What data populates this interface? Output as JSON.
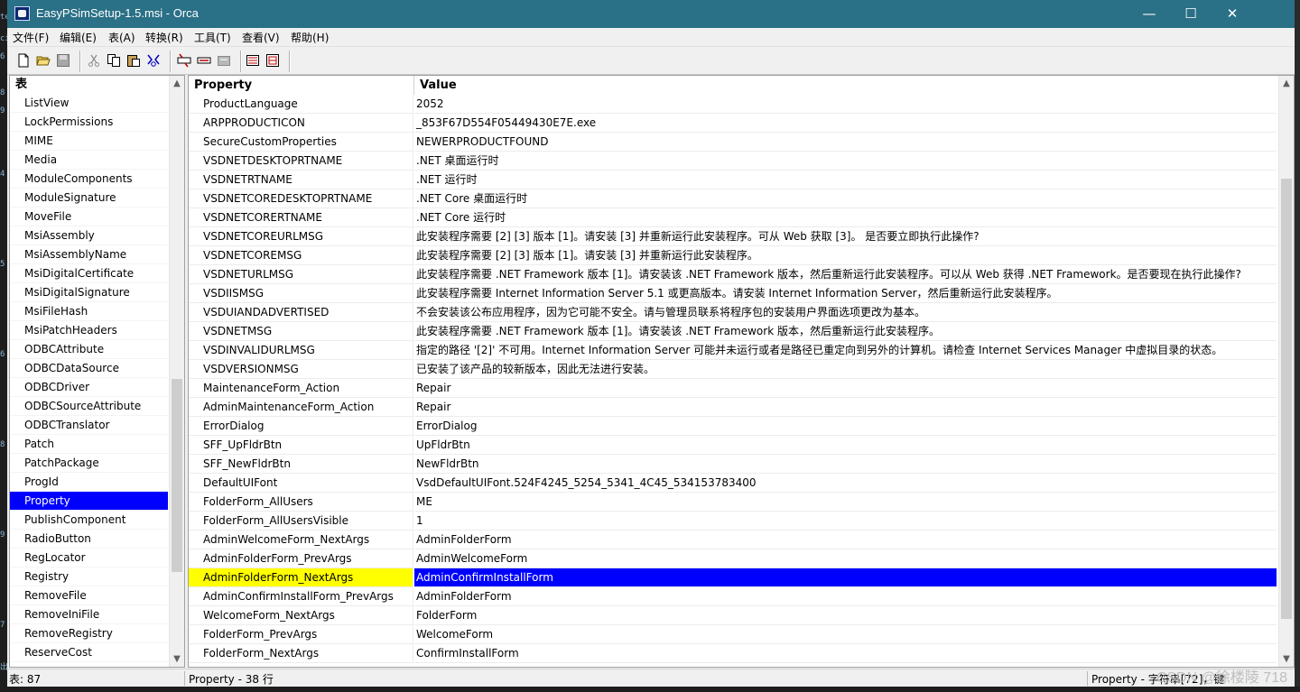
{
  "window": {
    "title": "EasyPSimSetup-1.5.msi - Orca",
    "minimize": "—",
    "maximize": "☐",
    "close": "✕"
  },
  "menu": [
    "文件(F)",
    "编辑(E)",
    "表(A)",
    "转换(R)",
    "工具(T)",
    "查看(V)",
    "帮助(H)"
  ],
  "tables_header": "表",
  "tables": [
    "ListView",
    "LockPermissions",
    "MIME",
    "Media",
    "ModuleComponents",
    "ModuleSignature",
    "MoveFile",
    "MsiAssembly",
    "MsiAssemblyName",
    "MsiDigitalCertificate",
    "MsiDigitalSignature",
    "MsiFileHash",
    "MsiPatchHeaders",
    "ODBCAttribute",
    "ODBCDataSource",
    "ODBCDriver",
    "ODBCSourceAttribute",
    "ODBCTranslator",
    "Patch",
    "PatchPackage",
    "ProgId",
    "Property",
    "PublishComponent",
    "RadioButton",
    "RegLocator",
    "Registry",
    "RemoveFile",
    "RemoveIniFile",
    "RemoveRegistry",
    "ReserveCost"
  ],
  "selected_table": "Property",
  "grid": {
    "columns": [
      "Property",
      "Value"
    ],
    "highlight_property": "AdminFolderForm_NextArgs",
    "rows": [
      [
        "ProductLanguage",
        "2052"
      ],
      [
        "ARPPRODUCTICON",
        "_853F67D554F05449430E7E.exe"
      ],
      [
        "SecureCustomProperties",
        "NEWERPRODUCTFOUND"
      ],
      [
        "VSDNETDESKTOPRTNAME",
        ".NET 桌面运行时"
      ],
      [
        "VSDNETRTNAME",
        ".NET 运行时"
      ],
      [
        "VSDNETCOREDESKTOPRTNAME",
        ".NET Core 桌面运行时"
      ],
      [
        "VSDNETCORERTNAME",
        ".NET Core 运行时"
      ],
      [
        "VSDNETCOREURLMSG",
        "此安装程序需要 [2] [3] 版本 [1]。请安装 [3] 并重新运行此安装程序。可从 Web 获取 [3]。 是否要立即执行此操作?"
      ],
      [
        "VSDNETCOREMSG",
        "此安装程序需要 [2] [3] 版本 [1]。请安装 [3] 并重新运行此安装程序。"
      ],
      [
        "VSDNETURLMSG",
        "此安装程序需要 .NET Framework 版本 [1]。请安装该 .NET Framework 版本，然后重新运行此安装程序。可以从 Web 获得 .NET Framework。是否要现在执行此操作?"
      ],
      [
        "VSDIISMSG",
        "此安装程序需要 Internet Information Server 5.1 或更高版本。请安装 Internet Information Server，然后重新运行此安装程序。"
      ],
      [
        "VSDUIANDADVERTISED",
        "不会安装该公布应用程序，因为它可能不安全。请与管理员联系将程序包的安装用户界面选项更改为基本。"
      ],
      [
        "VSDNETMSG",
        "此安装程序需要 .NET Framework 版本 [1]。请安装该 .NET Framework 版本，然后重新运行此安装程序。"
      ],
      [
        "VSDINVALIDURLMSG",
        "指定的路径 '[2]' 不可用。Internet Information Server 可能并未运行或者是路径已重定向到另外的计算机。请检查 Internet Services Manager 中虚拟目录的状态。"
      ],
      [
        "VSDVERSIONMSG",
        "已安装了该产品的较新版本，因此无法进行安装。"
      ],
      [
        "MaintenanceForm_Action",
        "Repair"
      ],
      [
        "AdminMaintenanceForm_Action",
        "Repair"
      ],
      [
        "ErrorDialog",
        "ErrorDialog"
      ],
      [
        "SFF_UpFldrBtn",
        "UpFldrBtn"
      ],
      [
        "SFF_NewFldrBtn",
        "NewFldrBtn"
      ],
      [
        "DefaultUIFont",
        "VsdDefaultUIFont.524F4245_5254_5341_4C45_534153783400"
      ],
      [
        "FolderForm_AllUsers",
        "ME"
      ],
      [
        "FolderForm_AllUsersVisible",
        "1"
      ],
      [
        "AdminWelcomeForm_NextArgs",
        "AdminFolderForm"
      ],
      [
        "AdminFolderForm_PrevArgs",
        "AdminWelcomeForm"
      ],
      [
        "AdminFolderForm_NextArgs",
        "AdminConfirmInstallForm"
      ],
      [
        "AdminConfirmInstallForm_PrevArgs",
        "AdminFolderForm"
      ],
      [
        "WelcomeForm_NextArgs",
        "FolderForm"
      ],
      [
        "FolderForm_PrevArgs",
        "WelcomeForm"
      ],
      [
        "FolderForm_NextArgs",
        "ConfirmInstallForm"
      ]
    ]
  },
  "status": {
    "tables": "表: 87",
    "rows": "Property - 38 行",
    "column": "Property - 字符串[72]，键"
  },
  "watermark": "CSDN @徐楼陵   718",
  "colors": {
    "title_bar": "#2a7086",
    "selection": "#0000ff",
    "highlight": "#ffff00"
  },
  "icons": [
    "new-file-icon",
    "open-folder-icon",
    "save-icon",
    "cut-icon",
    "copy-icon",
    "paste-icon",
    "find-icon",
    "tool-a-icon",
    "tool-b-icon",
    "tool-c-icon",
    "validate-icon",
    "transform-icon"
  ]
}
